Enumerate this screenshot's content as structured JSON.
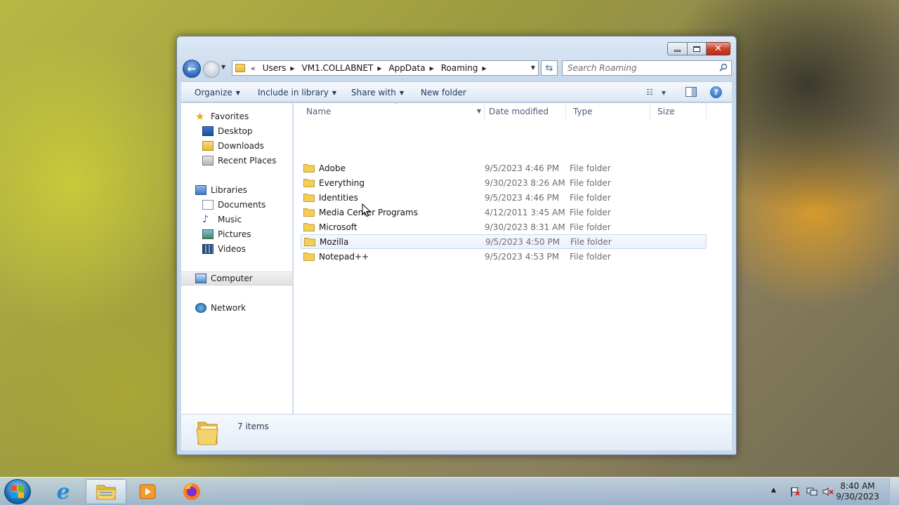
{
  "window": {
    "address": {
      "overflow": "«",
      "crumbs": [
        "Users",
        "VM1.COLLABNET",
        "AppData",
        "Roaming"
      ]
    },
    "search": {
      "placeholder": "Search Roaming"
    }
  },
  "toolbar": {
    "organize": "Organize",
    "include_in_library": "Include in library",
    "share_with": "Share with",
    "new_folder": "New folder"
  },
  "navpane": {
    "favorites": "Favorites",
    "desktop": "Desktop",
    "downloads": "Downloads",
    "recent_places": "Recent Places",
    "libraries": "Libraries",
    "documents": "Documents",
    "music": "Music",
    "pictures": "Pictures",
    "videos": "Videos",
    "computer": "Computer",
    "network": "Network"
  },
  "columns": {
    "name": "Name",
    "date_modified": "Date modified",
    "type": "Type",
    "size": "Size"
  },
  "files": [
    {
      "name": "Adobe",
      "date": "9/5/2023 4:46 PM",
      "type": "File folder"
    },
    {
      "name": "Everything",
      "date": "9/30/2023 8:26 AM",
      "type": "File folder"
    },
    {
      "name": "Identities",
      "date": "9/5/2023 4:46 PM",
      "type": "File folder"
    },
    {
      "name": "Media Center Programs",
      "date": "4/12/2011 3:45 AM",
      "type": "File folder"
    },
    {
      "name": "Microsoft",
      "date": "9/30/2023 8:31 AM",
      "type": "File folder"
    },
    {
      "name": "Mozilla",
      "date": "9/5/2023 4:50 PM",
      "type": "File folder"
    },
    {
      "name": "Notepad++",
      "date": "9/5/2023 4:53 PM",
      "type": "File folder"
    }
  ],
  "details": {
    "count": "7 items"
  },
  "taskbar": {
    "time": "8:40 AM",
    "date": "9/30/2023"
  },
  "colors": {
    "title_accent": "#1e395b",
    "selection": "#c7d9ef",
    "close_red": "#c9422b"
  }
}
